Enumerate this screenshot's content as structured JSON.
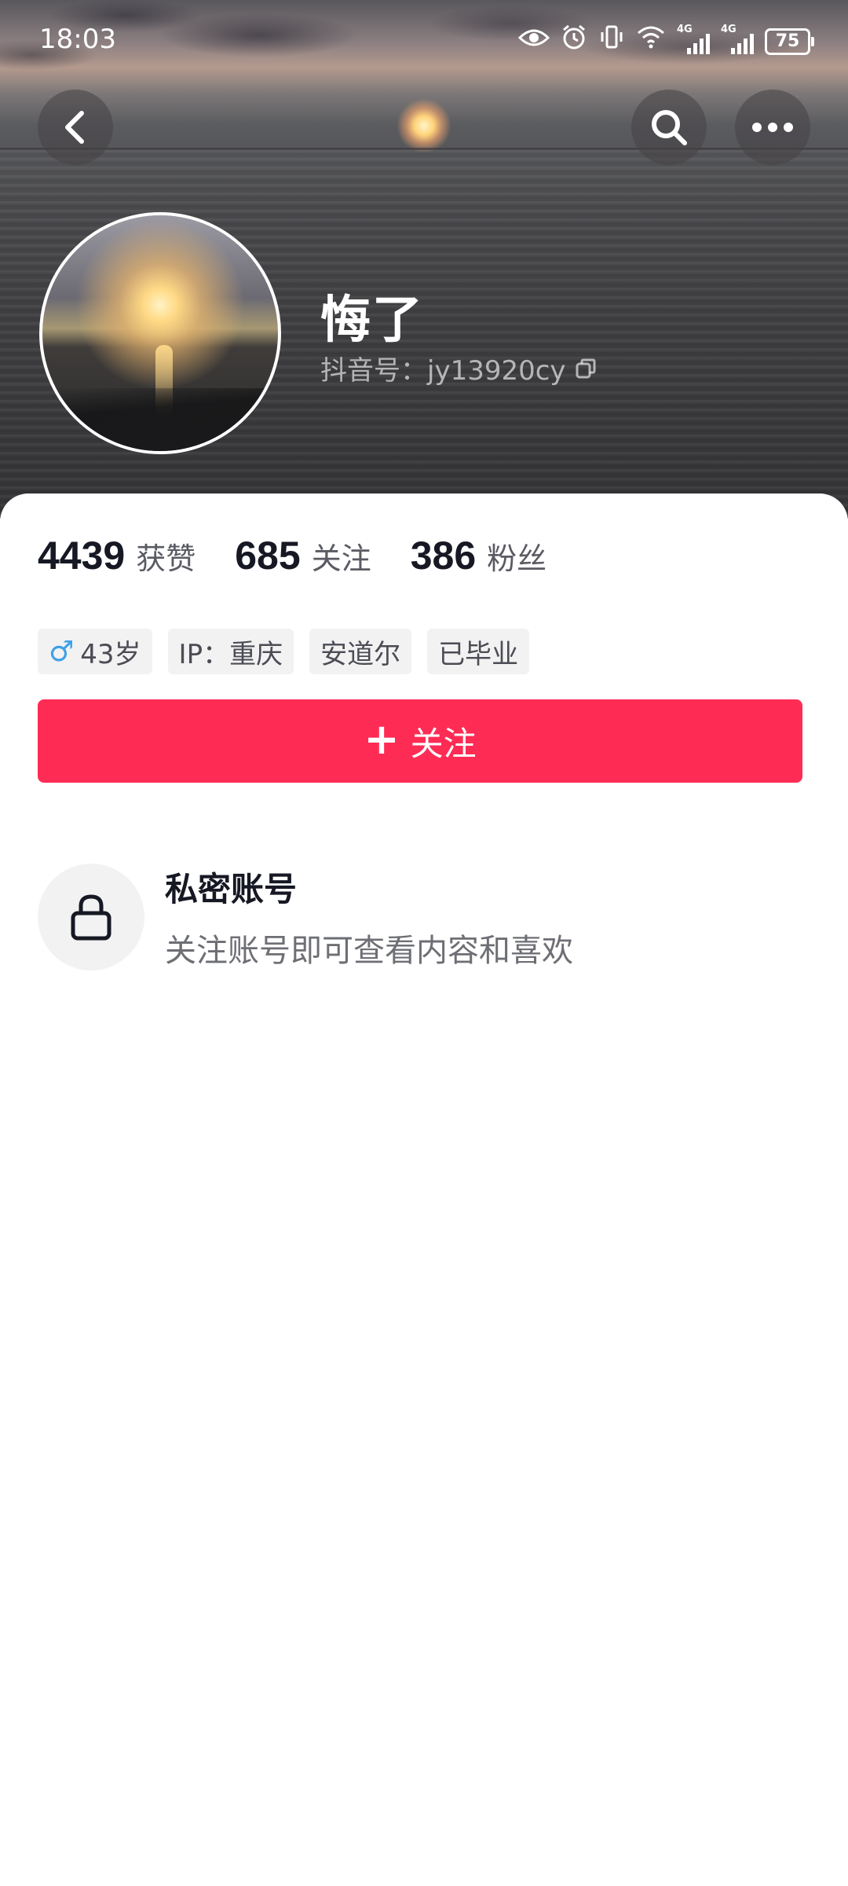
{
  "status_bar": {
    "time": "18:03",
    "network_1": "4G",
    "network_2": "4G",
    "battery": "75"
  },
  "profile": {
    "name": "悔了",
    "douyin_id": "抖音号：jy13920cy"
  },
  "stats": [
    {
      "value": "4439",
      "label": "获赞"
    },
    {
      "value": "685",
      "label": "关注"
    },
    {
      "value": "386",
      "label": "粉丝"
    }
  ],
  "tags": {
    "gender_symbol": "♂",
    "age": "43岁",
    "ip": "IP：重庆",
    "location": "安道尔",
    "school": "已毕业"
  },
  "follow_button": {
    "icon": "+",
    "label": "关注"
  },
  "private_account": {
    "title": "私密账号",
    "description": "关注账号即可查看内容和喜欢"
  },
  "colors": {
    "accent": "#fe2c55",
    "male": "#3fa0e6"
  },
  "icons": [
    "back-icon",
    "search-icon",
    "more-icon",
    "lock-icon",
    "copy-icon",
    "eye-icon",
    "alarm-icon",
    "vibrate-icon",
    "wifi-icon",
    "signal-icon",
    "battery-icon"
  ]
}
